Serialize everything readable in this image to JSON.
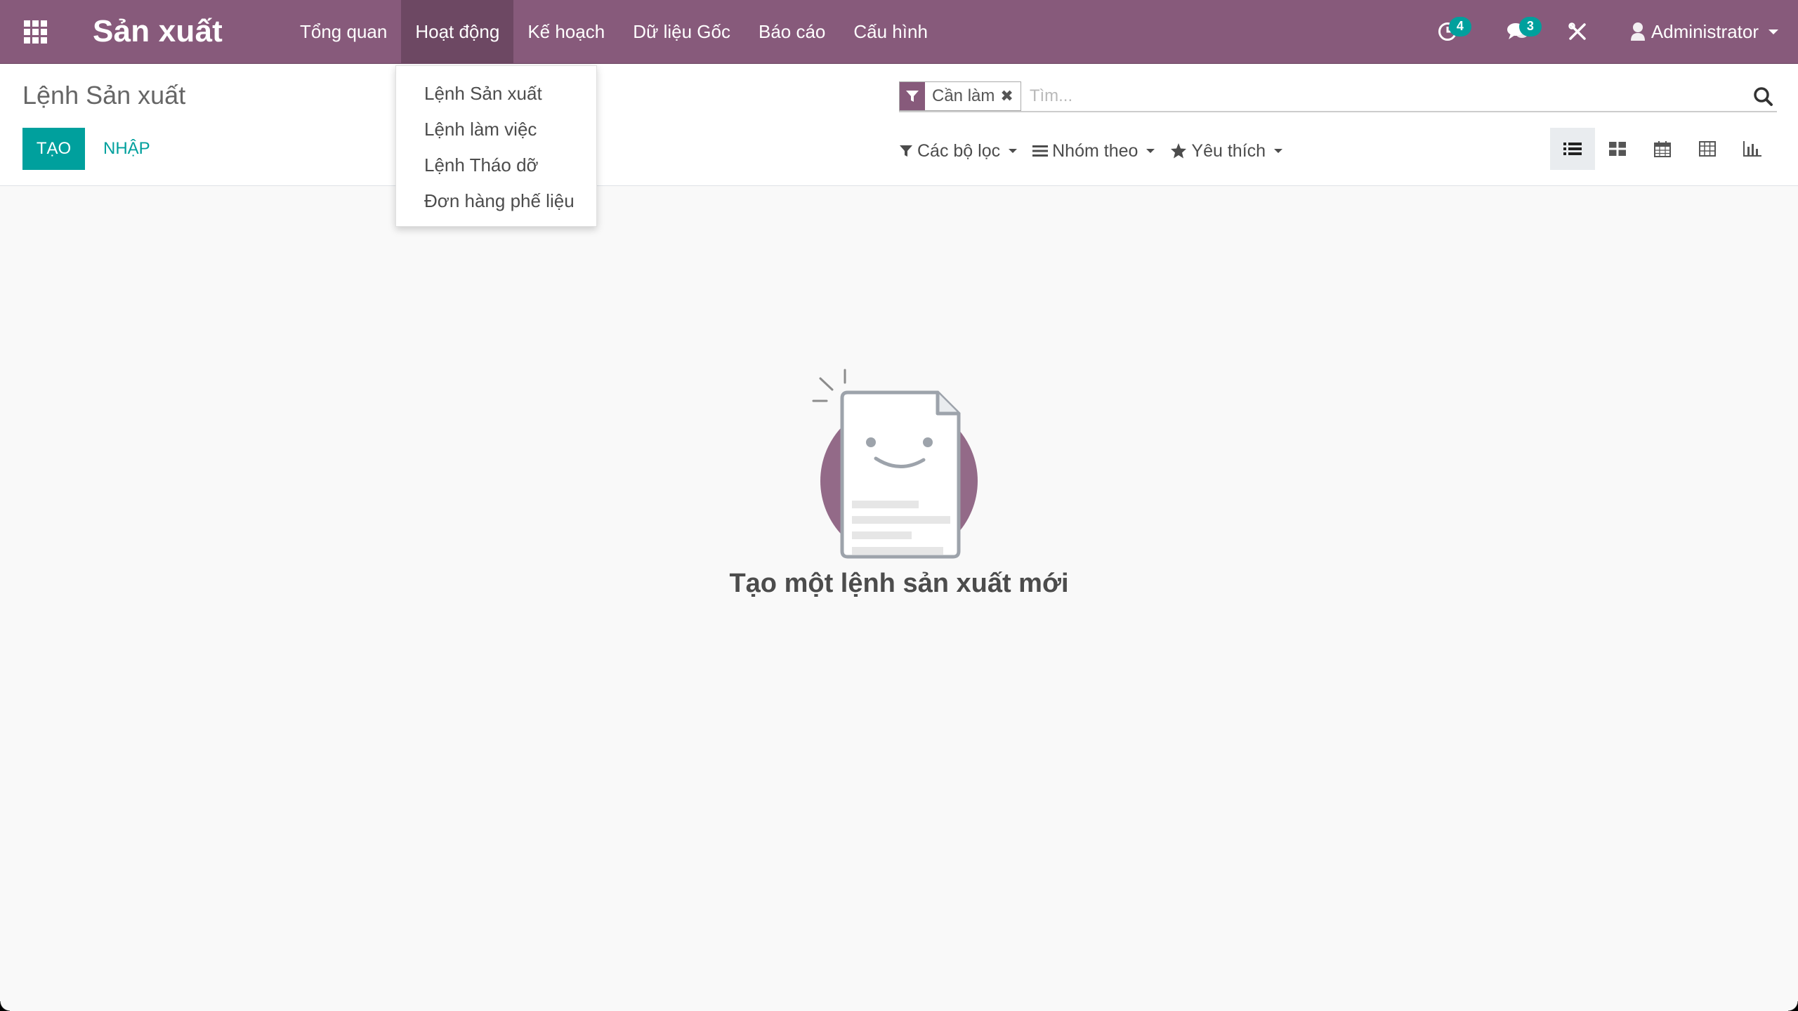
{
  "navbar": {
    "brand": "Sản xuất",
    "menu": [
      {
        "label": "Tổng quan"
      },
      {
        "label": "Hoạt động"
      },
      {
        "label": "Kế hoạch"
      },
      {
        "label": "Dữ liệu Gốc"
      },
      {
        "label": "Báo cáo"
      },
      {
        "label": "Cấu hình"
      }
    ],
    "activities_count": "4",
    "messages_count": "3",
    "user": "Administrator",
    "brand_color": "#875a7b",
    "badge_color": "#00a09d"
  },
  "dropdown": {
    "items": [
      {
        "label": "Lệnh Sản xuất"
      },
      {
        "label": "Lệnh làm việc"
      },
      {
        "label": "Lệnh Tháo dỡ"
      },
      {
        "label": "Đơn hàng phế liệu"
      }
    ]
  },
  "control_panel": {
    "breadcrumb": "Lệnh Sản xuất",
    "create_label": "TẠO",
    "import_label": "NHẬP",
    "search": {
      "facet": "Cần làm",
      "placeholder": "Tìm..."
    },
    "filters": {
      "filters_label": "Các bộ lọc",
      "groupby_label": "Nhóm theo",
      "favorites_label": "Yêu thích"
    },
    "views": [
      "list-icon",
      "kanban-icon",
      "calendar-icon",
      "pivot-icon",
      "graph-icon"
    ]
  },
  "empty_state": {
    "title": "Tạo một lệnh sản xuất mới"
  }
}
